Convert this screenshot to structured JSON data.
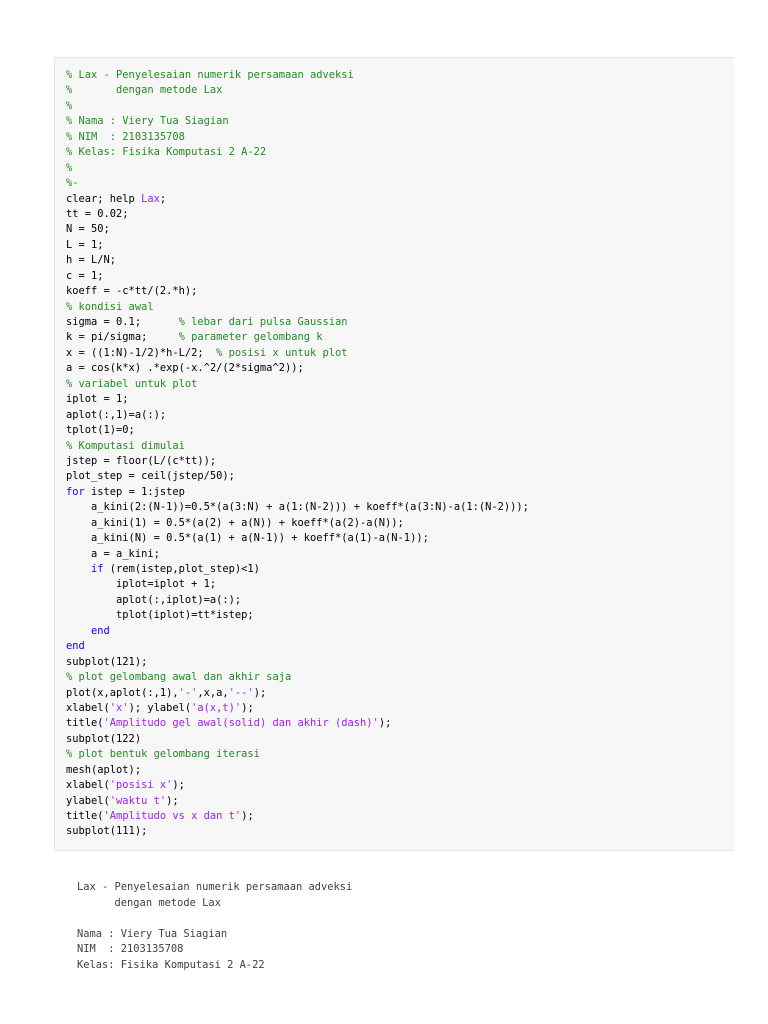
{
  "colors": {
    "comment": "#228b22",
    "keyword": "#0e00ff",
    "string": "#a020f0",
    "text": "#000000",
    "output_text": "#404040",
    "code_background": "#f7f7f7"
  },
  "code_lines": [
    [
      {
        "t": "% Lax - Penyelesaian numerik persamaan adveksi",
        "c": "comment"
      }
    ],
    [
      {
        "t": "%       dengan metode Lax",
        "c": "comment"
      }
    ],
    [
      {
        "t": "%",
        "c": "comment"
      }
    ],
    [
      {
        "t": "% Nama : Viery Tua Siagian",
        "c": "comment"
      }
    ],
    [
      {
        "t": "% NIM  : 2103135708",
        "c": "comment"
      }
    ],
    [
      {
        "t": "% Kelas: Fisika Komputasi 2 A-22",
        "c": "comment"
      }
    ],
    [
      {
        "t": "%",
        "c": "comment"
      }
    ],
    [
      {
        "t": "%-",
        "c": "comment"
      }
    ],
    [
      {
        "t": "clear; help ",
        "c": "plain"
      },
      {
        "t": "Lax",
        "c": "string"
      },
      {
        "t": ";",
        "c": "plain"
      }
    ],
    [
      {
        "t": "tt = 0.02;",
        "c": "plain"
      }
    ],
    [
      {
        "t": "N = 50;",
        "c": "plain"
      }
    ],
    [
      {
        "t": "L = 1;",
        "c": "plain"
      }
    ],
    [
      {
        "t": "h = L/N;",
        "c": "plain"
      }
    ],
    [
      {
        "t": "c = 1;",
        "c": "plain"
      }
    ],
    [
      {
        "t": "koeff = -c*tt/(2.*h);",
        "c": "plain"
      }
    ],
    [
      {
        "t": "% kondisi awal",
        "c": "comment"
      }
    ],
    [
      {
        "t": "sigma = 0.1;      ",
        "c": "plain"
      },
      {
        "t": "% lebar dari pulsa Gaussian",
        "c": "comment"
      }
    ],
    [
      {
        "t": "k = pi/sigma;     ",
        "c": "plain"
      },
      {
        "t": "% parameter gelombang k",
        "c": "comment"
      }
    ],
    [
      {
        "t": "x = ((1:N)-1/2)*h-L/2;  ",
        "c": "plain"
      },
      {
        "t": "% posisi x untuk plot",
        "c": "comment"
      }
    ],
    [
      {
        "t": "a = cos(k*x) .*exp(-x.^2/(2*sigma^2));",
        "c": "plain"
      }
    ],
    [
      {
        "t": "% variabel untuk plot",
        "c": "comment"
      }
    ],
    [
      {
        "t": "iplot = 1;",
        "c": "plain"
      }
    ],
    [
      {
        "t": "aplot(:,1)=a(:);",
        "c": "plain"
      }
    ],
    [
      {
        "t": "tplot(1)=0;",
        "c": "plain"
      }
    ],
    [
      {
        "t": "% Komputasi dimulai",
        "c": "comment"
      }
    ],
    [
      {
        "t": "jstep = floor(L/(c*tt));",
        "c": "plain"
      }
    ],
    [
      {
        "t": "plot_step = ceil(jstep/50);",
        "c": "plain"
      }
    ],
    [
      {
        "t": "for",
        "c": "keyword"
      },
      {
        "t": " istep = 1:jstep",
        "c": "plain"
      }
    ],
    [
      {
        "t": "    a_kini(2:(N-1))=0.5*(a(3:N) + a(1:(N-2))) + koeff*(a(3:N)-a(1:(N-2)));",
        "c": "plain"
      }
    ],
    [
      {
        "t": "    a_kini(1) = 0.5*(a(2) + a(N)) + koeff*(a(2)-a(N));",
        "c": "plain"
      }
    ],
    [
      {
        "t": "    a_kini(N) = 0.5*(a(1) + a(N-1)) + koeff*(a(1)-a(N-1));",
        "c": "plain"
      }
    ],
    [
      {
        "t": "    a = a_kini;",
        "c": "plain"
      }
    ],
    [
      {
        "t": "    ",
        "c": "plain"
      },
      {
        "t": "if",
        "c": "keyword"
      },
      {
        "t": " (rem(istep,plot_step)<1)",
        "c": "plain"
      }
    ],
    [
      {
        "t": "        iplot=iplot + 1;",
        "c": "plain"
      }
    ],
    [
      {
        "t": "        aplot(:,iplot)=a(:);",
        "c": "plain"
      }
    ],
    [
      {
        "t": "        tplot(iplot)=tt*istep;",
        "c": "plain"
      }
    ],
    [
      {
        "t": "    ",
        "c": "plain"
      },
      {
        "t": "end",
        "c": "keyword"
      }
    ],
    [
      {
        "t": "end",
        "c": "keyword"
      }
    ],
    [
      {
        "t": "subplot(121);",
        "c": "plain"
      }
    ],
    [
      {
        "t": "% plot gelombang awal dan akhir saja",
        "c": "comment"
      }
    ],
    [
      {
        "t": "plot(x,aplot(:,1),",
        "c": "plain"
      },
      {
        "t": "'-'",
        "c": "string"
      },
      {
        "t": ",x,a,",
        "c": "plain"
      },
      {
        "t": "'--'",
        "c": "string"
      },
      {
        "t": ");",
        "c": "plain"
      }
    ],
    [
      {
        "t": "xlabel(",
        "c": "plain"
      },
      {
        "t": "'x'",
        "c": "string"
      },
      {
        "t": "); ylabel(",
        "c": "plain"
      },
      {
        "t": "'a(x,t)'",
        "c": "string"
      },
      {
        "t": ");",
        "c": "plain"
      }
    ],
    [
      {
        "t": "title(",
        "c": "plain"
      },
      {
        "t": "'Amplitudo gel awal(solid) dan akhir (dash)'",
        "c": "string"
      },
      {
        "t": ");",
        "c": "plain"
      }
    ],
    [
      {
        "t": "subplot(122)",
        "c": "plain"
      }
    ],
    [
      {
        "t": "% plot bentuk gelombang iterasi",
        "c": "comment"
      }
    ],
    [
      {
        "t": "mesh(aplot);",
        "c": "plain"
      }
    ],
    [
      {
        "t": "xlabel(",
        "c": "plain"
      },
      {
        "t": "'posisi x'",
        "c": "string"
      },
      {
        "t": ");",
        "c": "plain"
      }
    ],
    [
      {
        "t": "ylabel(",
        "c": "plain"
      },
      {
        "t": "'waktu t'",
        "c": "string"
      },
      {
        "t": ");",
        "c": "plain"
      }
    ],
    [
      {
        "t": "title(",
        "c": "plain"
      },
      {
        "t": "'Amplitudo vs x dan t'",
        "c": "string"
      },
      {
        "t": ");",
        "c": "plain"
      }
    ],
    [
      {
        "t": "subplot(111);",
        "c": "plain"
      }
    ]
  ],
  "output_lines": [
    "Lax - Penyelesaian numerik persamaan adveksi",
    "      dengan metode Lax",
    "",
    "Nama : Viery Tua Siagian",
    "NIM  : 2103135708",
    "Kelas: Fisika Komputasi 2 A-22"
  ]
}
